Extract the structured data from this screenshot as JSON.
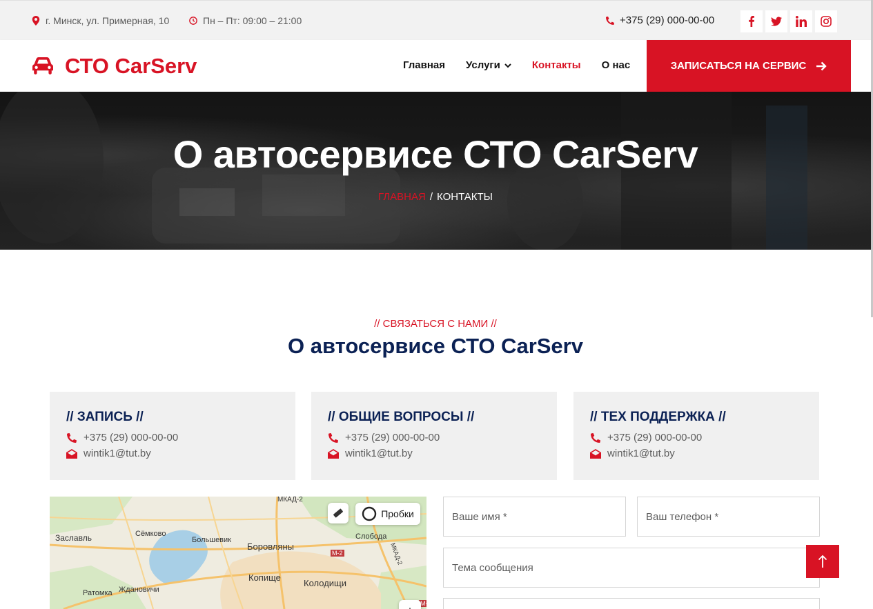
{
  "topbar": {
    "address": "г. Минск, ул. Примерная, 10",
    "hours": "Пн – Пт: 09:00 – 21:00",
    "phone": "+375 (29) 000-00-00",
    "socials": [
      "facebook-icon",
      "twitter-icon",
      "linkedin-icon",
      "instagram-icon"
    ]
  },
  "brand": {
    "name": "СТО CarServ",
    "icon": "car-icon"
  },
  "nav": {
    "items": [
      {
        "label": "Главная"
      },
      {
        "label": "Услуги"
      },
      {
        "label": "Контакты"
      },
      {
        "label": "О нас"
      }
    ],
    "cta_label": "ЗАПИСАТЬСЯ НА СЕРВИС"
  },
  "hero": {
    "title": "О автосервисе СТО CarServ",
    "breadcrumb_home": "ГЛАВНАЯ",
    "breadcrumb_sep": "/",
    "breadcrumb_current": "КОНТАКТЫ"
  },
  "section": {
    "subtitle": "// СВЯЗАТЬСЯ С НАМИ //",
    "title": "О автосервисе СТО CarServ"
  },
  "cards": [
    {
      "title": "// ЗАПИСЬ //",
      "phone": "+375 (29) 000-00-00",
      "email": "wintik1@tut.by"
    },
    {
      "title": "// ОБЩИЕ ВОПРОСЫ //",
      "phone": "+375 (29) 000-00-00",
      "email": "wintik1@tut.by"
    },
    {
      "title": "// ТЕХ ПОДДЕРЖКА //",
      "phone": "+375 (29) 000-00-00",
      "email": "wintik1@tut.by"
    }
  ],
  "map": {
    "traffic_label": "Пробки",
    "zoom_in": "+",
    "labels": [
      "МКАД-2",
      "Заславль",
      "Сёмково",
      "Большевик",
      "Боровляны",
      "Слобода",
      "М-2",
      "МКАД-2",
      "Копище",
      "Колодищи",
      "Ратомка",
      "Ждановичи",
      "М-2"
    ]
  },
  "form": {
    "name_placeholder": "Ваше имя *",
    "phone_placeholder": "Ваш телефон *",
    "subject_placeholder": "Тема сообщения"
  },
  "colors": {
    "accent": "#d81324",
    "dark": "#0b2154",
    "light_bg": "#f2f2f2"
  }
}
